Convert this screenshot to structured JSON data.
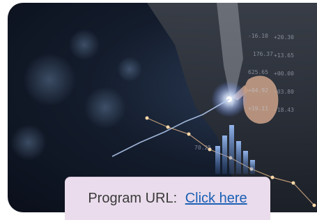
{
  "program": {
    "label": "Program URL:",
    "link_text": "Click here"
  },
  "image": {
    "ticker_values": [
      "-16.10",
      "+20.30",
      "176.37",
      "+13.65",
      "625.65",
      "+00.00",
      "+04.92",
      "-03.80",
      "+18.43",
      "+19.11",
      "70.25"
    ]
  },
  "colors": {
    "cta_background": "#eadcec",
    "link": "#1a5fb4",
    "text": "#3a3a3a"
  }
}
